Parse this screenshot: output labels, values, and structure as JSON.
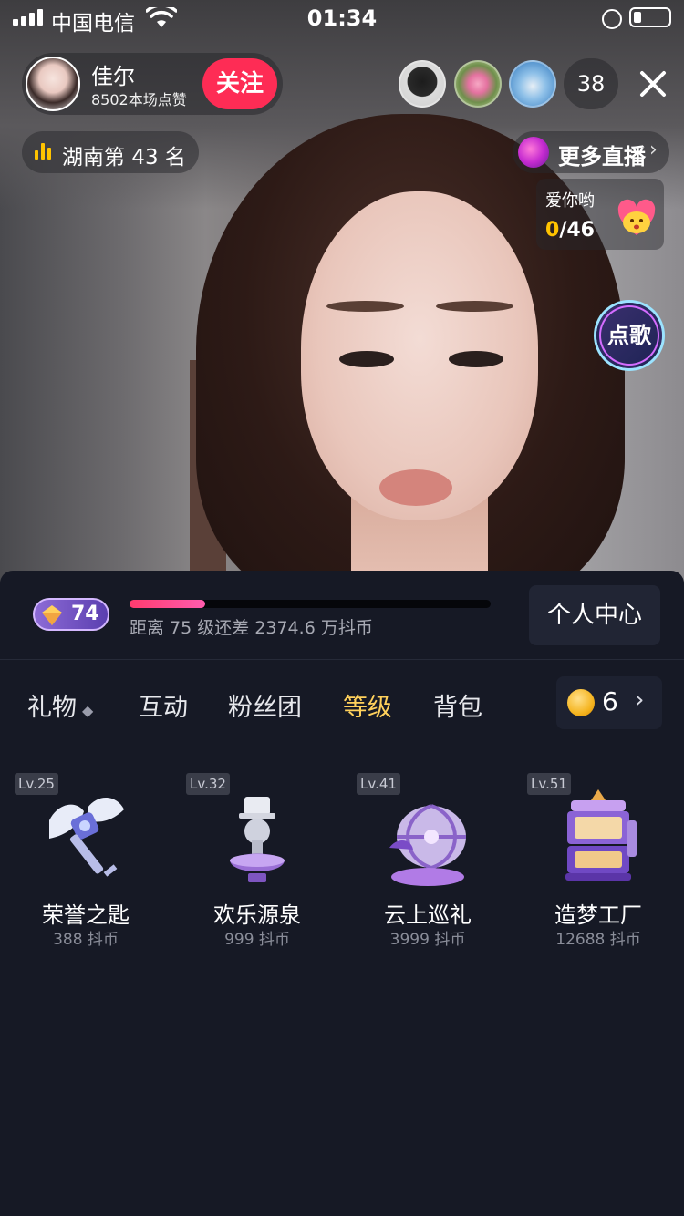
{
  "status_bar": {
    "carrier": "中国电信",
    "time": "01:34"
  },
  "host": {
    "name": "佳尔",
    "likes": "8502本场点赞",
    "follow_label": "关注"
  },
  "viewers": {
    "count": "38"
  },
  "rank": {
    "text": "湖南第 43 名"
  },
  "more_live": {
    "label": "更多直播",
    "chevron": "›"
  },
  "love_task": {
    "title": "爱你哟",
    "current": "0",
    "total": "/46"
  },
  "song_button": {
    "label": "点歌"
  },
  "level": {
    "badge_number": "74",
    "progress_fraction": 0.21,
    "progress_text": "距离 75 级还差 2374.6 万抖币",
    "center_button": "个人中心"
  },
  "tabs": [
    {
      "label": "礼物",
      "sort_icon": "◆"
    },
    {
      "label": "互动"
    },
    {
      "label": "粉丝团"
    },
    {
      "label": "等级",
      "active": true
    },
    {
      "label": "背包"
    }
  ],
  "coins": {
    "balance": "6",
    "chevron": "›"
  },
  "gifts": [
    {
      "level": "Lv.25",
      "name": "荣誉之匙",
      "price": "388 抖币",
      "icon": "winged-key-icon"
    },
    {
      "level": "Lv.32",
      "name": "欢乐源泉",
      "price": "999 抖币",
      "icon": "fountain-icon"
    },
    {
      "level": "Lv.41",
      "name": "云上巡礼",
      "price": "3999 抖币",
      "icon": "airship-icon"
    },
    {
      "level": "Lv.51",
      "name": "造梦工厂",
      "price": "12688 抖币",
      "icon": "dream-factory-icon"
    }
  ],
  "colors": {
    "follow": "#fe2c55",
    "active_tab": "#ffd15c",
    "panel_bg": "#161925",
    "rank_icon": "#ffc300"
  }
}
